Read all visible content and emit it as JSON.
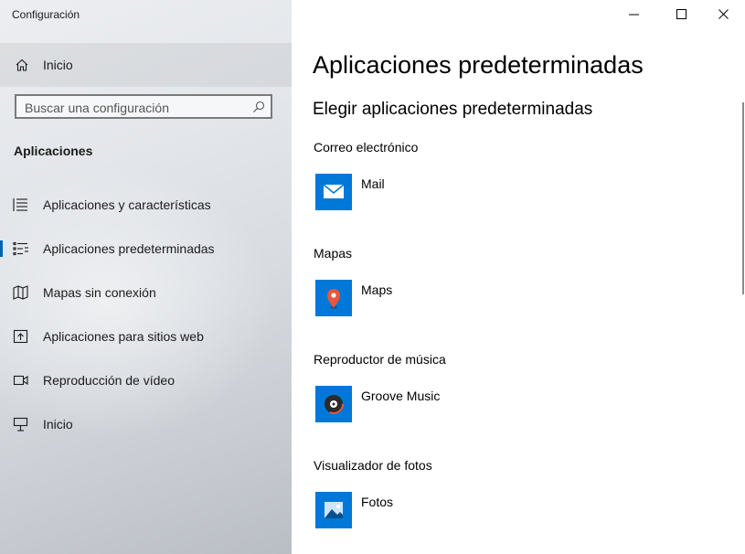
{
  "window": {
    "title": "Configuración"
  },
  "sidebar": {
    "home_label": "Inicio",
    "search_placeholder": "Buscar una configuración",
    "section_title": "Aplicaciones",
    "items": [
      {
        "label": "Aplicaciones y características",
        "icon": "list-icon",
        "selected": false
      },
      {
        "label": "Aplicaciones predeterminadas",
        "icon": "default-apps-icon",
        "selected": true
      },
      {
        "label": "Mapas sin conexión",
        "icon": "map-icon",
        "selected": false
      },
      {
        "label": "Aplicaciones para sitios web",
        "icon": "open-website-icon",
        "selected": false
      },
      {
        "label": "Reproducción de vídeo",
        "icon": "video-icon",
        "selected": false
      },
      {
        "label": "Inicio",
        "icon": "startup-icon",
        "selected": false
      }
    ]
  },
  "main": {
    "title": "Aplicaciones predeterminadas",
    "subtitle": "Elegir aplicaciones predeterminadas",
    "defaults": [
      {
        "category": "Correo electrónico",
        "app": "Mail",
        "icon": "mail-icon"
      },
      {
        "category": "Mapas",
        "app": "Maps",
        "icon": "maps-pin-icon"
      },
      {
        "category": "Reproductor de música",
        "app": "Groove Music",
        "icon": "groove-music-icon"
      },
      {
        "category": "Visualizador de fotos",
        "app": "Fotos",
        "icon": "photos-icon"
      }
    ]
  },
  "colors": {
    "accent": "#0063b1",
    "tile": "#0078d7"
  }
}
